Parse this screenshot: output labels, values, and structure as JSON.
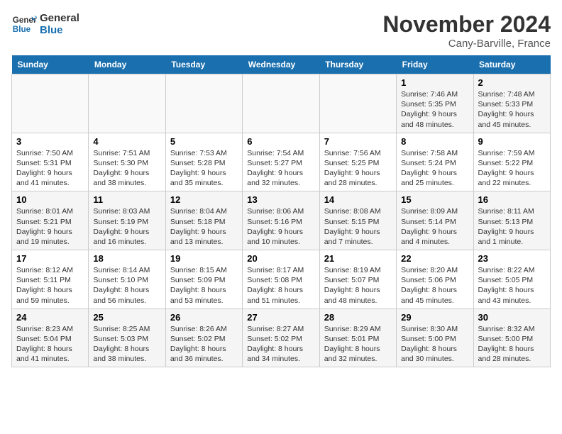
{
  "header": {
    "logo_line1": "General",
    "logo_line2": "Blue",
    "month": "November 2024",
    "location": "Cany-Barville, France"
  },
  "weekdays": [
    "Sunday",
    "Monday",
    "Tuesday",
    "Wednesday",
    "Thursday",
    "Friday",
    "Saturday"
  ],
  "weeks": [
    [
      {
        "day": "",
        "info": ""
      },
      {
        "day": "",
        "info": ""
      },
      {
        "day": "",
        "info": ""
      },
      {
        "day": "",
        "info": ""
      },
      {
        "day": "",
        "info": ""
      },
      {
        "day": "1",
        "info": "Sunrise: 7:46 AM\nSunset: 5:35 PM\nDaylight: 9 hours and 48 minutes."
      },
      {
        "day": "2",
        "info": "Sunrise: 7:48 AM\nSunset: 5:33 PM\nDaylight: 9 hours and 45 minutes."
      }
    ],
    [
      {
        "day": "3",
        "info": "Sunrise: 7:50 AM\nSunset: 5:31 PM\nDaylight: 9 hours and 41 minutes."
      },
      {
        "day": "4",
        "info": "Sunrise: 7:51 AM\nSunset: 5:30 PM\nDaylight: 9 hours and 38 minutes."
      },
      {
        "day": "5",
        "info": "Sunrise: 7:53 AM\nSunset: 5:28 PM\nDaylight: 9 hours and 35 minutes."
      },
      {
        "day": "6",
        "info": "Sunrise: 7:54 AM\nSunset: 5:27 PM\nDaylight: 9 hours and 32 minutes."
      },
      {
        "day": "7",
        "info": "Sunrise: 7:56 AM\nSunset: 5:25 PM\nDaylight: 9 hours and 28 minutes."
      },
      {
        "day": "8",
        "info": "Sunrise: 7:58 AM\nSunset: 5:24 PM\nDaylight: 9 hours and 25 minutes."
      },
      {
        "day": "9",
        "info": "Sunrise: 7:59 AM\nSunset: 5:22 PM\nDaylight: 9 hours and 22 minutes."
      }
    ],
    [
      {
        "day": "10",
        "info": "Sunrise: 8:01 AM\nSunset: 5:21 PM\nDaylight: 9 hours and 19 minutes."
      },
      {
        "day": "11",
        "info": "Sunrise: 8:03 AM\nSunset: 5:19 PM\nDaylight: 9 hours and 16 minutes."
      },
      {
        "day": "12",
        "info": "Sunrise: 8:04 AM\nSunset: 5:18 PM\nDaylight: 9 hours and 13 minutes."
      },
      {
        "day": "13",
        "info": "Sunrise: 8:06 AM\nSunset: 5:16 PM\nDaylight: 9 hours and 10 minutes."
      },
      {
        "day": "14",
        "info": "Sunrise: 8:08 AM\nSunset: 5:15 PM\nDaylight: 9 hours and 7 minutes."
      },
      {
        "day": "15",
        "info": "Sunrise: 8:09 AM\nSunset: 5:14 PM\nDaylight: 9 hours and 4 minutes."
      },
      {
        "day": "16",
        "info": "Sunrise: 8:11 AM\nSunset: 5:13 PM\nDaylight: 9 hours and 1 minute."
      }
    ],
    [
      {
        "day": "17",
        "info": "Sunrise: 8:12 AM\nSunset: 5:11 PM\nDaylight: 8 hours and 59 minutes."
      },
      {
        "day": "18",
        "info": "Sunrise: 8:14 AM\nSunset: 5:10 PM\nDaylight: 8 hours and 56 minutes."
      },
      {
        "day": "19",
        "info": "Sunrise: 8:15 AM\nSunset: 5:09 PM\nDaylight: 8 hours and 53 minutes."
      },
      {
        "day": "20",
        "info": "Sunrise: 8:17 AM\nSunset: 5:08 PM\nDaylight: 8 hours and 51 minutes."
      },
      {
        "day": "21",
        "info": "Sunrise: 8:19 AM\nSunset: 5:07 PM\nDaylight: 8 hours and 48 minutes."
      },
      {
        "day": "22",
        "info": "Sunrise: 8:20 AM\nSunset: 5:06 PM\nDaylight: 8 hours and 45 minutes."
      },
      {
        "day": "23",
        "info": "Sunrise: 8:22 AM\nSunset: 5:05 PM\nDaylight: 8 hours and 43 minutes."
      }
    ],
    [
      {
        "day": "24",
        "info": "Sunrise: 8:23 AM\nSunset: 5:04 PM\nDaylight: 8 hours and 41 minutes."
      },
      {
        "day": "25",
        "info": "Sunrise: 8:25 AM\nSunset: 5:03 PM\nDaylight: 8 hours and 38 minutes."
      },
      {
        "day": "26",
        "info": "Sunrise: 8:26 AM\nSunset: 5:02 PM\nDaylight: 8 hours and 36 minutes."
      },
      {
        "day": "27",
        "info": "Sunrise: 8:27 AM\nSunset: 5:02 PM\nDaylight: 8 hours and 34 minutes."
      },
      {
        "day": "28",
        "info": "Sunrise: 8:29 AM\nSunset: 5:01 PM\nDaylight: 8 hours and 32 minutes."
      },
      {
        "day": "29",
        "info": "Sunrise: 8:30 AM\nSunset: 5:00 PM\nDaylight: 8 hours and 30 minutes."
      },
      {
        "day": "30",
        "info": "Sunrise: 8:32 AM\nSunset: 5:00 PM\nDaylight: 8 hours and 28 minutes."
      }
    ]
  ]
}
